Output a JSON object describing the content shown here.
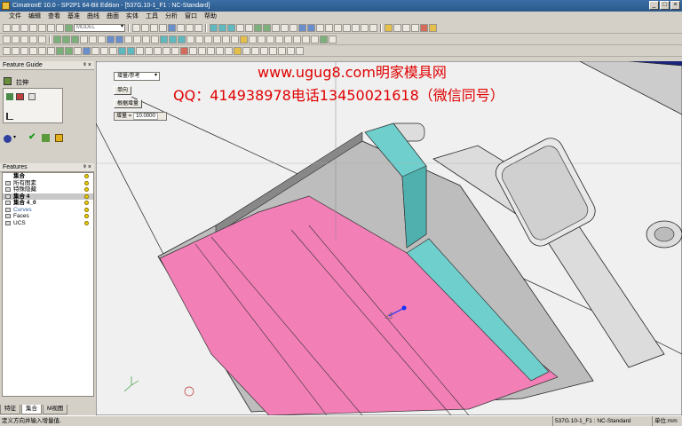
{
  "window": {
    "title": "CimatronE 10.0 - SP2P1 64-Bit Edition - [537G.10-1_F1 : NC-Standard]",
    "buttons": [
      "_",
      "□",
      "×"
    ]
  },
  "menu": [
    "文件",
    "编辑",
    "查看",
    "基准",
    "曲线",
    "曲面",
    "实体",
    "工具",
    "分析",
    "窗口",
    "帮助"
  ],
  "toolbar": {
    "model_combo": "MODEL"
  },
  "feature_guide": {
    "title": "Feature Guide",
    "pin": "ᵠ ×",
    "step_label": "拉伸"
  },
  "features_panel": {
    "title": "Features",
    "pin": "ᵠ ×",
    "items": [
      {
        "label": "集合",
        "style": "bold"
      },
      {
        "label": "所有图素",
        "style": "normal"
      },
      {
        "label": "特殊隐藏",
        "style": "normal"
      },
      {
        "label": "集合 4",
        "style": "sel"
      },
      {
        "label": "集合 4_0",
        "style": "bold"
      },
      {
        "label": "Curves",
        "style": "muted"
      },
      {
        "label": "Faces",
        "style": "normal"
      },
      {
        "label": "UCS",
        "style": "normal"
      }
    ]
  },
  "bottom_tabs": [
    "特征",
    "集合",
    "M视图"
  ],
  "viewport_ui": {
    "mode_combo": "增量/参考",
    "direction_btn": "单向",
    "increment_btn": "根据增量",
    "increment_field_label": "增量 =",
    "increment_value": "10.0000"
  },
  "watermark": {
    "line1": "www.ugug8.com明家模具网",
    "line2": "QQ：414938978电话13450021618（微信同号）"
  },
  "status": {
    "message": "定义方向并输入增量值.",
    "document": "537G.10-1_F1 : NC-Standard",
    "unit": "单位:mm"
  },
  "colors": {
    "pink_face": "#f27fb6",
    "teal_face": "#6ecfcc",
    "watermark": "#e00000",
    "titlebar": "#3a6ea5"
  }
}
